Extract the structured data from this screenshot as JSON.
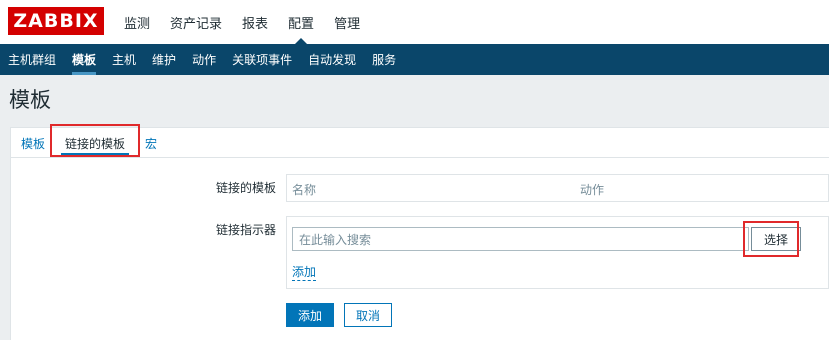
{
  "logo": {
    "text": "ZABBIX"
  },
  "main_menu": [
    "监测",
    "资产记录",
    "报表",
    "配置",
    "管理"
  ],
  "sub_menu": [
    "主机群组",
    "模板",
    "主机",
    "维护",
    "动作",
    "关联项事件",
    "自动发现",
    "服务"
  ],
  "page": {
    "title": "模板"
  },
  "tabs": [
    "模板",
    "链接的模板",
    "宏"
  ],
  "form": {
    "linked_templates_label": "链接的模板",
    "col_name": "名称",
    "col_action": "动作",
    "link_indicator_label": "链接指示器",
    "search_placeholder": "在此输入搜索",
    "select_label": "选择",
    "add_link": "添加"
  },
  "buttons": {
    "add": "添加",
    "cancel": "取消"
  },
  "colors": {
    "brand": "#d40000",
    "subnav": "#0a466a",
    "accent": "#0275b8",
    "highlight": "#e0292b"
  }
}
